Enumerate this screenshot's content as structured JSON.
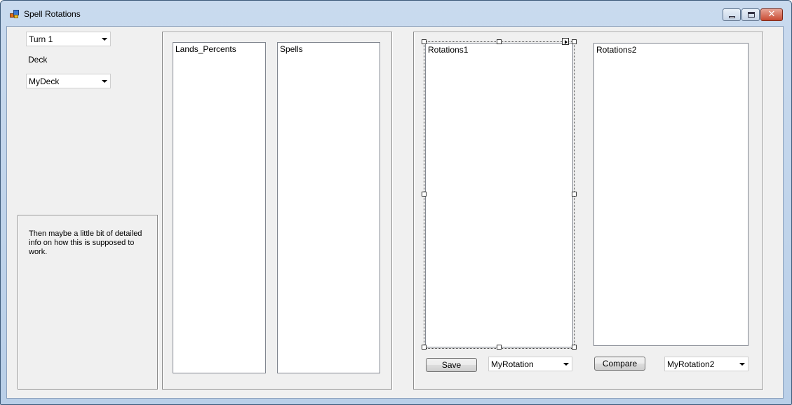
{
  "window": {
    "title": "Spell Rotations"
  },
  "left_panel": {
    "turn_select": {
      "value": "Turn 1"
    },
    "deck_label": "Deck",
    "deck_select": {
      "value": "MyDeck"
    },
    "info_text": "Then maybe a little bit of detailed info on how this is supposed to work."
  },
  "middle_panel": {
    "lists": [
      {
        "items": [
          "Lands_Percents"
        ]
      },
      {
        "items": [
          "Spells"
        ]
      }
    ]
  },
  "right_panel": {
    "rotations1": {
      "items": [
        "Rotations1"
      ]
    },
    "rotations2": {
      "items": [
        "Rotations2"
      ]
    },
    "save_label": "Save",
    "rotation_select": {
      "value": "MyRotation"
    },
    "compare_label": "Compare",
    "rotation2_select": {
      "value": "MyRotation2"
    }
  },
  "icons": {
    "app": "app-icon",
    "minimize": "minimize-icon",
    "maximize": "maximize-icon",
    "close": "close-icon",
    "dropdown": "chevron-down-icon"
  },
  "colors": {
    "titlebar": "#c9daee",
    "client_bg": "#f0f0f0",
    "close_button": "#c84a32"
  }
}
